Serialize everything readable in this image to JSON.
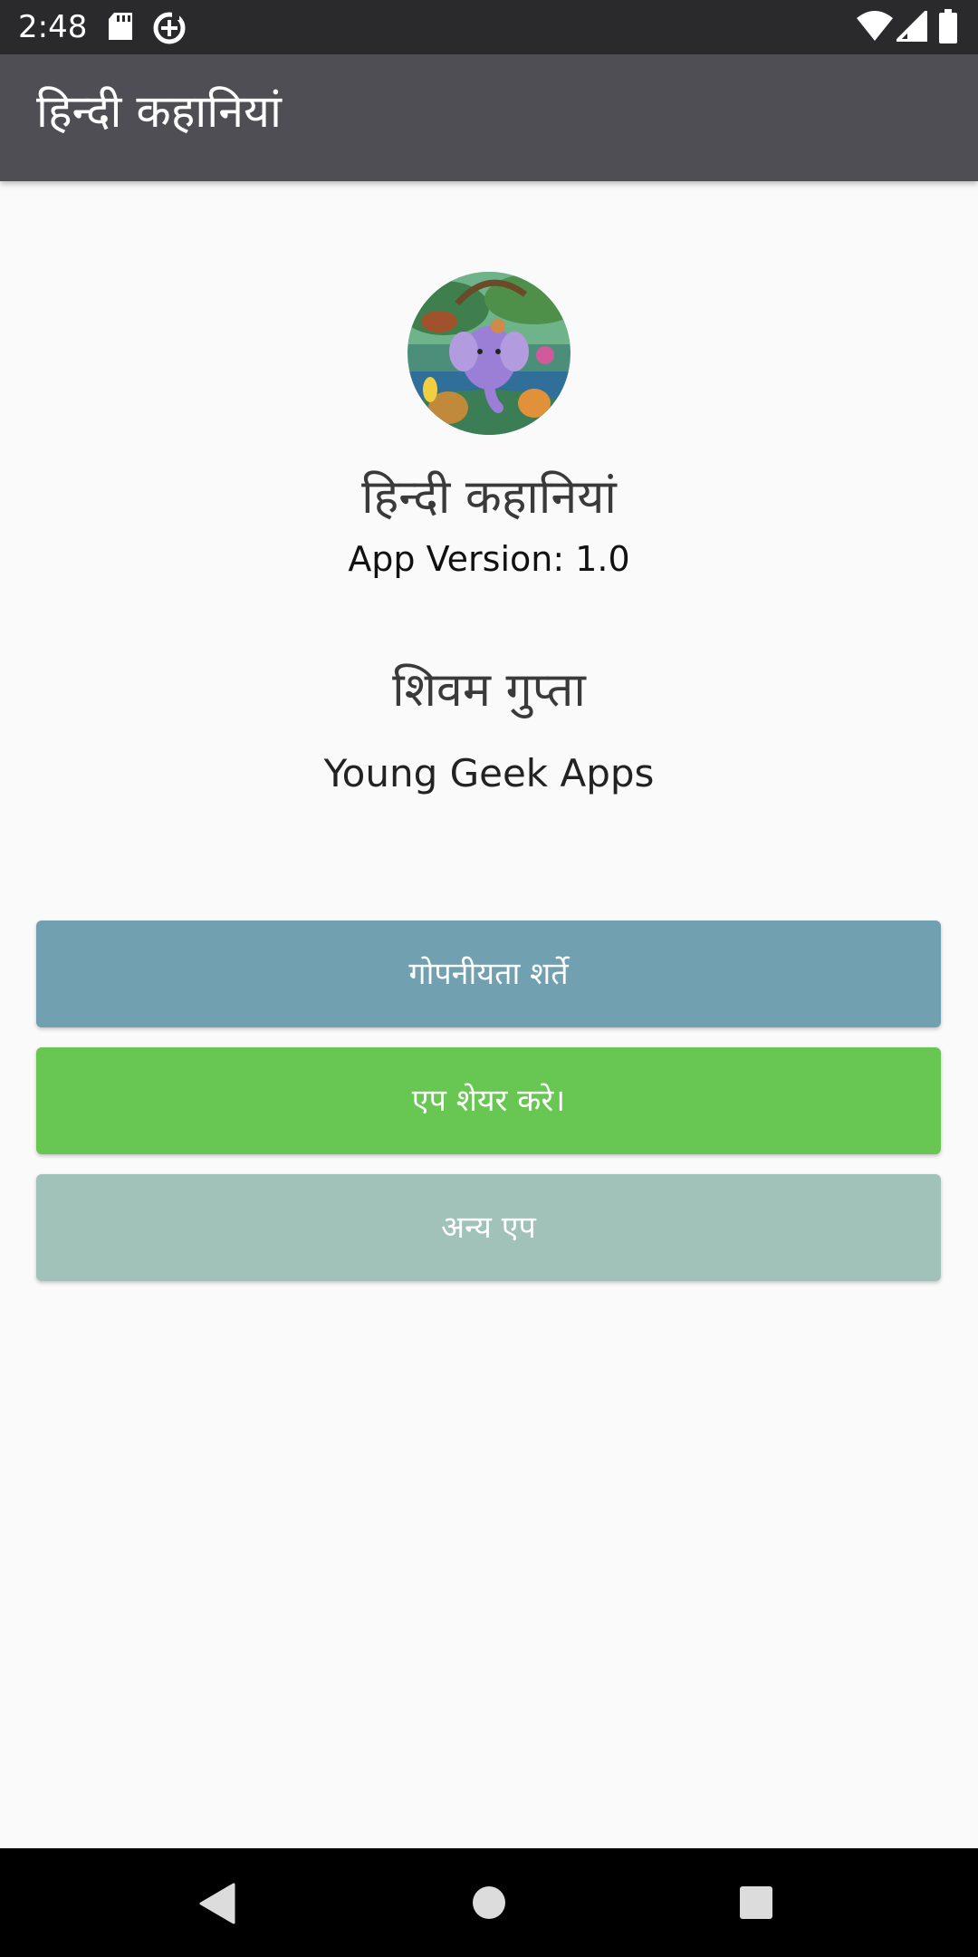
{
  "status_bar": {
    "time": "2:48",
    "icons": [
      "sd-card-icon",
      "data-saver-icon",
      "wifi-icon",
      "cellular-signal-icon",
      "battery-icon"
    ]
  },
  "app_bar": {
    "title": "हिन्दी कहानियां"
  },
  "about": {
    "logo_icon": "app-logo-elephant-icon",
    "app_name": "हिन्दी कहानियां",
    "app_version": "App Version: 1.0",
    "developer_name": "शिवम गुप्ता",
    "company_name": "Young Geek Apps"
  },
  "buttons": {
    "privacy_label": "गोपनीयता शर्ते",
    "share_label": "एप शेयर करे।",
    "more_apps_label": "अन्य एप"
  },
  "colors": {
    "status_bar": "#2a2a2c",
    "app_bar": "#4f4e54",
    "background": "#fafafa",
    "privacy_button": "#71a0b0",
    "share_button": "#68c653",
    "more_apps_button": "#a0c2b8",
    "nav_bar": "#000000"
  },
  "nav_bar": {
    "icons": [
      "back-icon",
      "home-icon",
      "recents-icon"
    ]
  }
}
